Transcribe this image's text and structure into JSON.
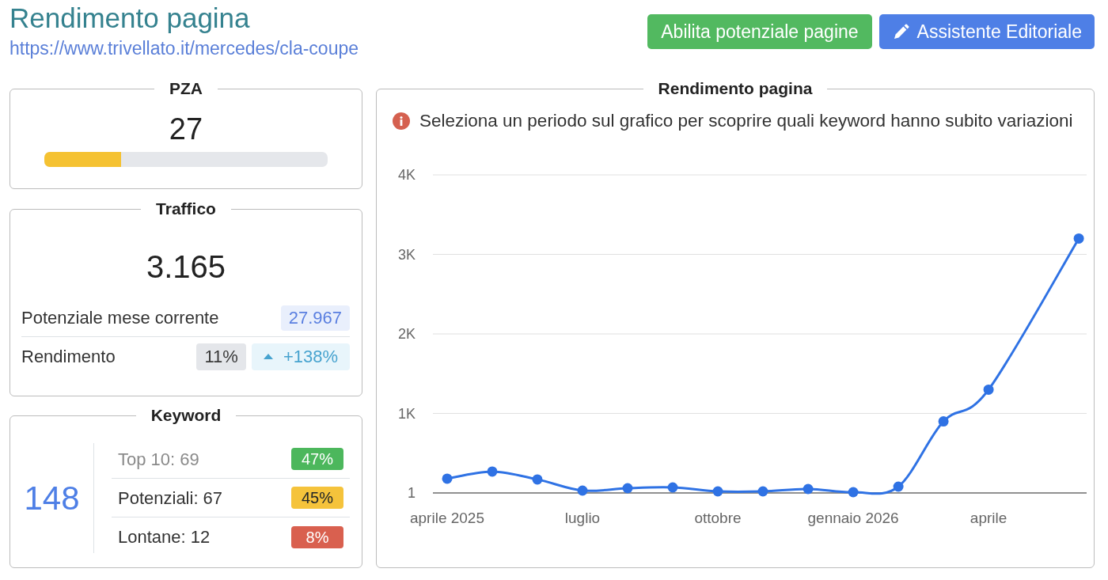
{
  "header": {
    "title": "Rendimento pagina",
    "url": "https://www.trivellato.it/mercedes/cla-coupe"
  },
  "actions": [
    {
      "kind": "success",
      "label": "Abilita potenziale pagine"
    },
    {
      "kind": "editor",
      "label": "Assistente Editoriale"
    }
  ],
  "pza": {
    "title": "PZA",
    "value": "27",
    "level": 0.27
  },
  "traffic": {
    "title": "Traffico",
    "value": "3.165",
    "potential": {
      "label": "Potenziale mese corrente",
      "value": "27.967"
    },
    "performance": {
      "label": "Rendimento",
      "value": "11%",
      "change": "+138%",
      "rising": true
    }
  },
  "keywords": {
    "title": "Keyword",
    "total": "148",
    "rows": [
      {
        "label": "Top 10: 69",
        "share": "47%",
        "color": "#4cb75c",
        "dimmed": true
      },
      {
        "label": "Potenziali: 67",
        "share": "45%",
        "color": "#f5c33b",
        "dimmed": false
      },
      {
        "label": "Lontane: 12",
        "share": "8%",
        "color": "#d9604f",
        "dimmed": false
      }
    ]
  },
  "chart_panel": {
    "title": "Rendimento pagina",
    "notice": "Seleziona un periodo sul grafico per scoprire quali keyword hanno subito variazioni",
    "chart_data": {
      "type": "line",
      "categories": [
        "aprile 2025",
        null,
        null,
        "luglio",
        null,
        null,
        "ottobre",
        null,
        null,
        "gennaio 2026",
        null,
        null,
        "aprile",
        null,
        null
      ],
      "values": [
        180,
        270,
        170,
        30,
        60,
        70,
        20,
        20,
        50,
        10,
        80,
        900,
        1300,
        null,
        3200
      ],
      "ylim": [
        0,
        4000
      ],
      "yticks": [
        {
          "value": 1,
          "label": "1"
        },
        {
          "value": 1000,
          "label": "1K"
        },
        {
          "value": 2000,
          "label": "2K"
        },
        {
          "value": 3000,
          "label": "3K"
        },
        {
          "value": 4000,
          "label": "4K"
        }
      ],
      "grid": true,
      "marker": "circle"
    }
  }
}
